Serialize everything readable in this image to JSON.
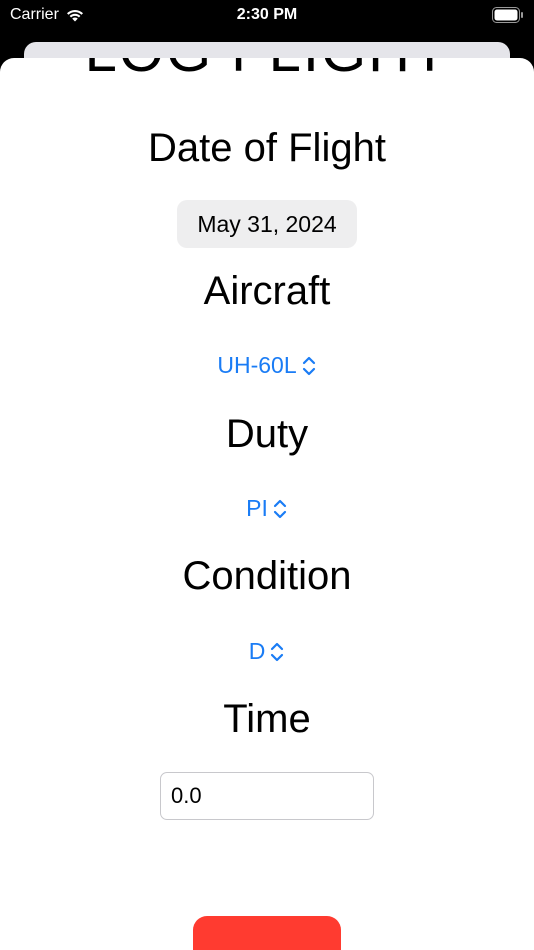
{
  "status_bar": {
    "carrier": "Carrier",
    "time": "2:30 PM"
  },
  "sheet": {
    "title": "LOG FLIGHT",
    "date_label": "Date of Flight",
    "date_value": "May 31, 2024",
    "aircraft_label": "Aircraft",
    "aircraft_value": "UH-60L",
    "duty_label": "Duty",
    "duty_value": "PI",
    "condition_label": "Condition",
    "condition_value": "D",
    "time_label": "Time",
    "time_value": "0.0"
  },
  "colors": {
    "accent": "#1a7cf5",
    "destructive": "#ff3b30"
  },
  "icons": [
    "wifi-icon",
    "battery-icon",
    "chevron-up-down-icon"
  ]
}
